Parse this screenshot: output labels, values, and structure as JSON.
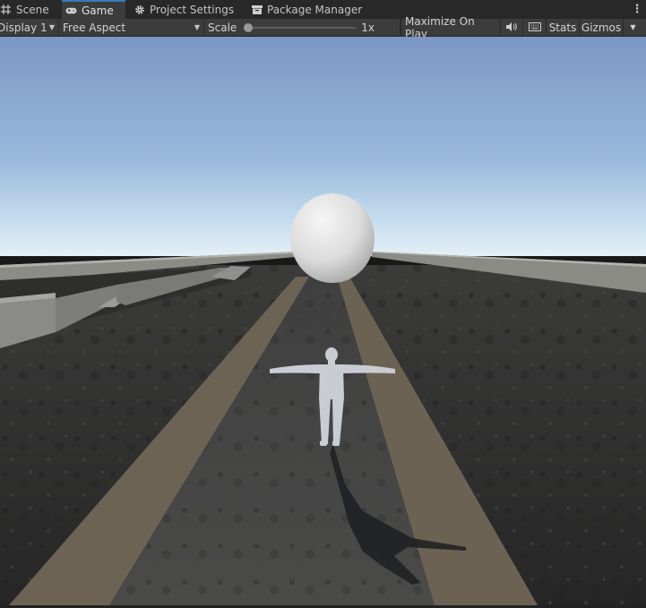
{
  "tabs": [
    {
      "label": "Scene",
      "icon": "grid-icon",
      "active": false
    },
    {
      "label": "Game",
      "icon": "gamepad-icon",
      "active": true
    },
    {
      "label": "Project Settings",
      "icon": "gear-icon",
      "active": false
    },
    {
      "label": "Package Manager",
      "icon": "package-icon",
      "active": false
    }
  ],
  "toolbar": {
    "display": "Display 1",
    "aspect": "Free Aspect",
    "scale_label": "Scale",
    "scale_value": "1x",
    "scale_fraction": 0.0,
    "maximize": "Maximize On Play",
    "mute_icon": "speaker-icon",
    "keyboard_icon": "keyboard-icon",
    "stats": "Stats",
    "gizmos": "Gizmos"
  },
  "colors": {
    "accent": "#3a79bb",
    "sky_top": "#7f9bc6",
    "sky_horizon": "#dbe9f4",
    "ground": "#2d2d2d"
  }
}
